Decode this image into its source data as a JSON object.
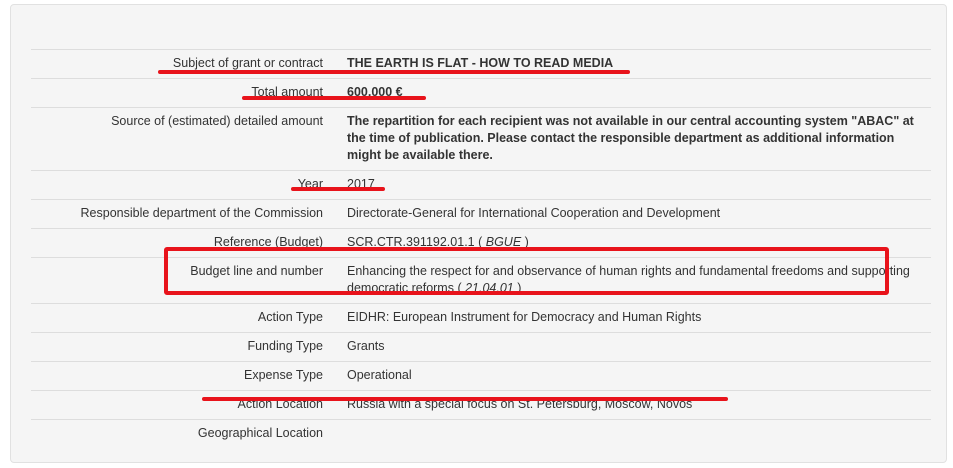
{
  "rows": [
    {
      "label": "Subject of grant or contract",
      "value": "THE EARTH IS FLAT - HOW TO READ MEDIA",
      "bold": true
    },
    {
      "label": "Total amount",
      "value": "600,000 €",
      "bold": true
    },
    {
      "label": "Source of (estimated) detailed amount",
      "value": "The repartition for each recipient was not available in our central accounting system \"ABAC\" at the time of publication. Please contact the responsible department as additional information might be available there.",
      "bold": true
    },
    {
      "label": "Year",
      "value": "2017",
      "bold": false
    },
    {
      "label": "Responsible department of the Commission",
      "value": "Directorate-General for International Cooperation and Development",
      "bold": false
    },
    {
      "label": "Reference (Budget)",
      "value": "SCR.CTR.391192.01.1",
      "code": "BGUE",
      "bold": false
    },
    {
      "label": "Budget line and number",
      "value": "Enhancing the respect for and observance of human rights and fundamental freedoms and supporting democratic reforms",
      "code": "21.04.01",
      "bold": false
    },
    {
      "label": "Action Type",
      "value": "EIDHR: European Instrument for Democracy and Human Rights",
      "bold": false
    },
    {
      "label": "Funding Type",
      "value": "Grants",
      "bold": false
    },
    {
      "label": "Expense Type",
      "value": "Operational",
      "bold": false
    },
    {
      "label": "Action Location",
      "value": "Russia with a special focus on St. Petersburg, Moscow, Novos",
      "bold": false
    },
    {
      "label": "Geographical Location",
      "value": "",
      "bold": false
    }
  ],
  "colors": {
    "annotation": "#e8131b",
    "panel_background": "#f5f5f5",
    "row_border": "#dddddd"
  }
}
